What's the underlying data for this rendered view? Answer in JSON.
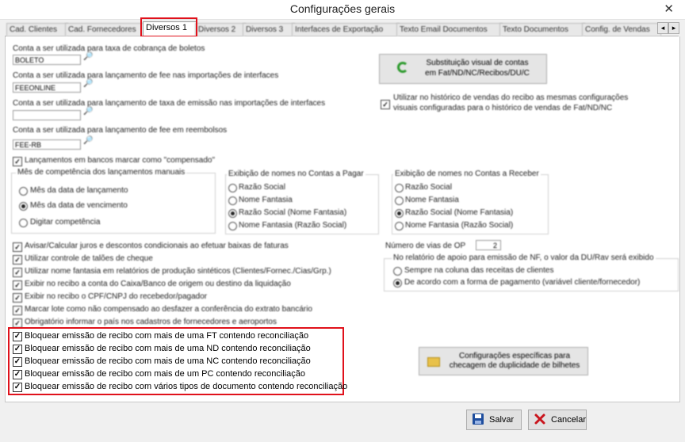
{
  "window": {
    "title": "Configurações gerais",
    "close_glyph": "✕"
  },
  "tabs": [
    {
      "label": "Cad. Clientes",
      "active": false
    },
    {
      "label": "Cad. Fornecedores",
      "active": false
    },
    {
      "label": "Diversos 1",
      "active": true
    },
    {
      "label": "Diversos 2",
      "active": false
    },
    {
      "label": "Diversos 3",
      "active": false
    },
    {
      "label": "Interfaces de Exportação",
      "active": false
    },
    {
      "label": "Texto Email Documentos",
      "active": false
    },
    {
      "label": "Texto Documentos",
      "active": false
    },
    {
      "label": "Config. de Vendas",
      "active": false
    }
  ],
  "tab_scroll": {
    "left": "◂",
    "right": "▸"
  },
  "accounts": [
    {
      "label": "Conta a ser utilizada para taxa de cobrança de boletos",
      "value": "BOLETO"
    },
    {
      "label": "Conta a ser utilizada para lançamento de fee nas importações de interfaces",
      "value": "FEEONLINE"
    },
    {
      "label": "Conta a ser utilizada para lançamento de taxa de emissão nas importações de interfaces",
      "value": ""
    },
    {
      "label": "Conta a ser utilizada para lançamento de fee em reembolsos",
      "value": "FEE-RB"
    }
  ],
  "visual_button": {
    "label_line1": "Substituição visual de contas",
    "label_line2": "em Fat/ND/NC/Recibos/DU/C"
  },
  "historic_check": {
    "checked": true,
    "line1": "Utilizar no histórico de vendas do recibo as mesmas configurações",
    "line2": "visuais configuradas para o histórico de vendas de Fat/ND/NC"
  },
  "bank_check": {
    "checked": true,
    "label": "Lançamentos em bancos marcar como \"compensado\""
  },
  "competencia": {
    "title": "Mês de competência dos lançamentos manuais",
    "options": [
      "Mês da data de lançamento",
      "Mês da data de vencimento",
      "Digitar competência"
    ],
    "selected": 1
  },
  "pagar": {
    "title": "Exibição de nomes no Contas a Pagar",
    "options": [
      "Razão Social",
      "Nome Fantasia",
      "Razão Social (Nome Fantasia)",
      "Nome Fantasia (Razão Social)"
    ],
    "selected": 2
  },
  "receber": {
    "title": "Exibição de nomes no Contas a Receber",
    "options": [
      "Razão Social",
      "Nome Fantasia",
      "Razão Social (Nome Fantasia)",
      "Nome Fantasia (Razão Social)"
    ],
    "selected": 2
  },
  "options_checks": [
    "Avisar/Calcular juros e descontos condicionais ao efetuar baixas de faturas",
    "Utilizar controle de talões de cheque",
    "Utilizar nome fantasia em relatórios de produção sintéticos (Clientes/Fornec./Cias/Grp.)",
    "Exibir no recibo a conta do Caixa/Banco de origem ou destino da liquidação",
    "Exibir no recibo o CPF/CNPJ do recebedor/pagador",
    "Marcar lote como não compensado ao desfazer a conferência do extrato bancário",
    "Obrigatório informar o país nos cadastros de fornecedores e aeroportos"
  ],
  "vias": {
    "label": "Número de vias de OP",
    "value": "2"
  },
  "relatorio": {
    "title": "No relatório de apoio para emissão de NF, o valor da DU/Rav será exibido",
    "options": [
      "Sempre na coluna das receitas de clientes",
      "De acordo com a forma de pagamento (variável cliente/fornecedor)"
    ],
    "selected": 1
  },
  "block_checks": [
    "Bloquear emissão de recibo com mais de uma FT contendo reconciliação",
    "Bloquear emissão de recibo com mais de uma ND contendo reconciliação",
    "Bloquear emissão de recibo com mais de uma NC contendo reconciliação",
    "Bloquear emissão de recibo com mais de um PC contendo reconciliação",
    "Bloquear emissão de recibo com vários tipos de documento contendo reconciliação"
  ],
  "duplicity_button": {
    "line1": "Configurações específicas para",
    "line2": "checagem de duplicidade de bilhetes"
  },
  "footer": {
    "save": "Salvar",
    "cancel": "Cancelar"
  },
  "colors": {
    "highlight": "#e0111b",
    "panel": "#ffffff",
    "chrome": "#f0f0f0"
  },
  "icons": [
    "search-icon",
    "refresh-icon",
    "folder-icon",
    "save-disk-icon",
    "cancel-x-icon"
  ]
}
